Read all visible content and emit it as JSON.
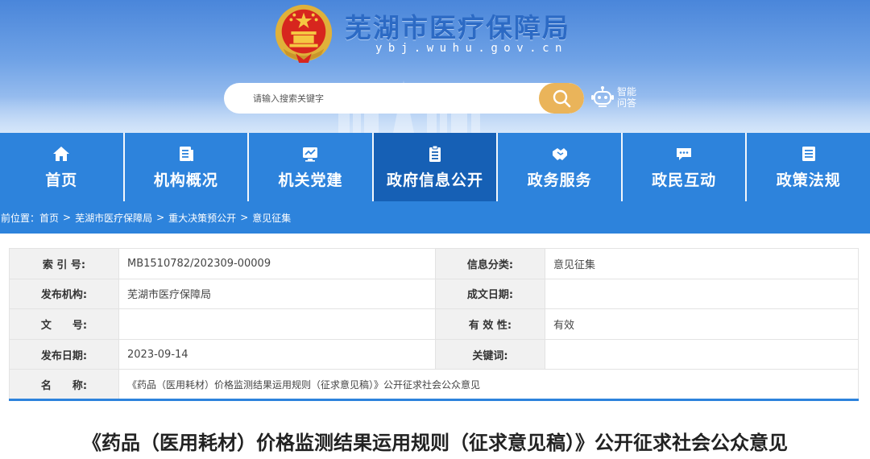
{
  "header": {
    "site_title": "芜湖市医疗保障局",
    "site_domain": "ybj.wuhu.gov.cn",
    "search_placeholder": "请输入搜索关键字",
    "ai_label": "智能问答"
  },
  "nav": {
    "items": [
      {
        "label": "首页",
        "icon": "home-icon"
      },
      {
        "label": "机构概况",
        "icon": "document-icon"
      },
      {
        "label": "机关党建",
        "icon": "monitor-icon"
      },
      {
        "label": "政府信息公开",
        "icon": "clipboard-icon",
        "active": true
      },
      {
        "label": "政务服务",
        "icon": "handshake-icon"
      },
      {
        "label": "政民互动",
        "icon": "chat-icon"
      },
      {
        "label": "政策法规",
        "icon": "list-icon"
      }
    ]
  },
  "breadcrumb": {
    "prefix": "当前位置：",
    "items": [
      "首页",
      "芜湖市医疗保障局",
      "重大决策预公开",
      "意见征集"
    ],
    "separator": ">"
  },
  "meta": {
    "index_label": "索 引 号:",
    "index_value": "MB1510782/202309-00009",
    "category_label": "信息分类:",
    "category_value": "意见征集",
    "publisher_label": "发布机构:",
    "publisher_value": "芜湖市医疗保障局",
    "written_date_label": "成文日期:",
    "written_date_value": "",
    "doc_no_label": "文　　号:",
    "doc_no_value": "",
    "validity_label": "有 效 性:",
    "validity_value": "有效",
    "publish_date_label": "发布日期:",
    "publish_date_value": "2023-09-14",
    "keywords_label": "关键词:",
    "keywords_value": "",
    "name_label": "名　　称:",
    "name_value": "《药品（医用耗材）价格监测结果运用规则（征求意见稿）》公开征求社会公众意见"
  },
  "article": {
    "title": "《药品（医用耗材）价格监测结果运用规则（征求意见稿）》公开征求社会公众意见"
  },
  "colors": {
    "nav_blue": "#2d83dc",
    "nav_active": "#1660b5",
    "search_button": "#eab45a",
    "title_blue": "#2c6ac4"
  }
}
